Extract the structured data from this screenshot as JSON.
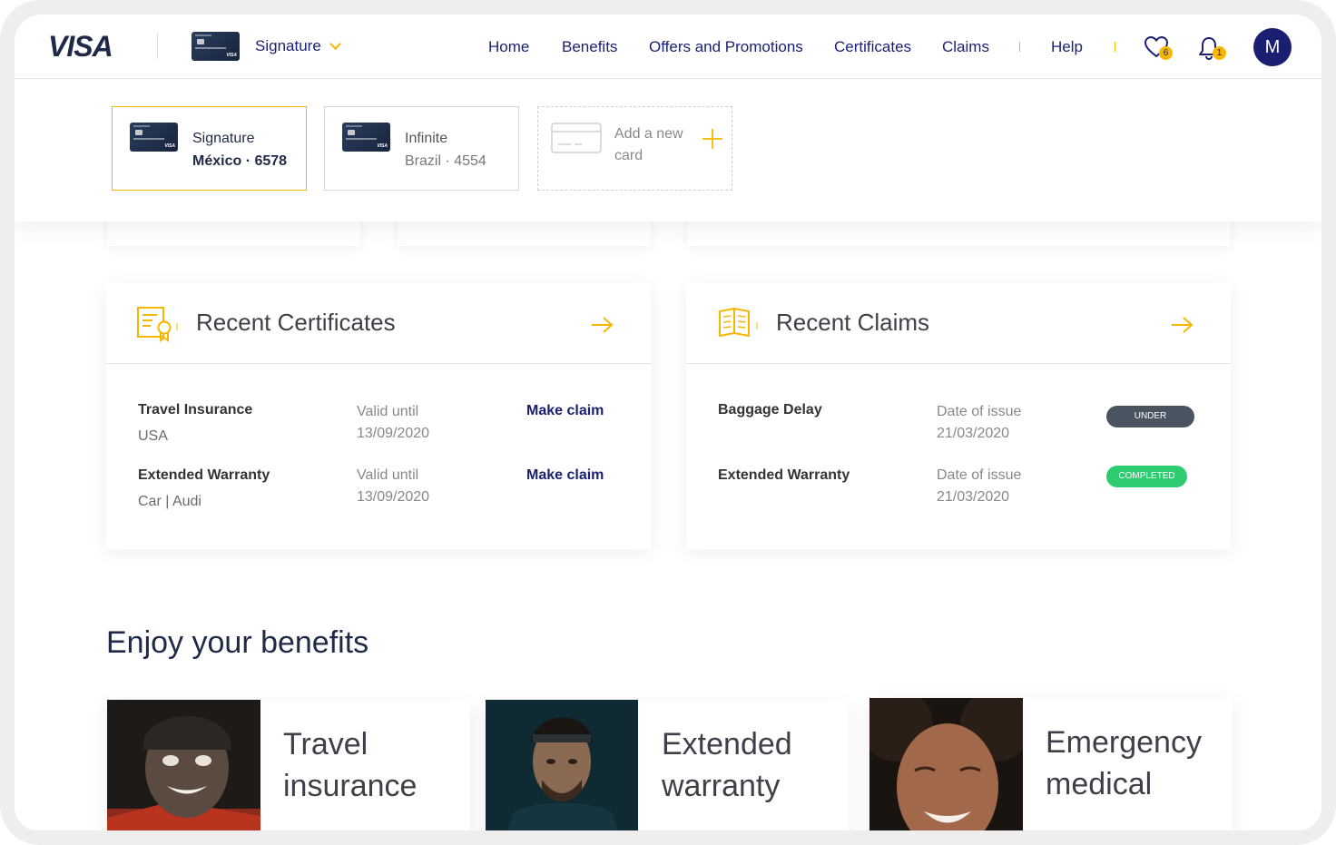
{
  "header": {
    "logo": "VISA",
    "selected_card": "Signature",
    "nav": [
      "Home",
      "Benefits",
      "Offers and Promotions",
      "Certificates",
      "Claims",
      "Help"
    ],
    "favorites_count": "6",
    "notifications_count": "1",
    "avatar_initial": "M"
  },
  "cards": [
    {
      "line1": "Signature",
      "line2": "México · 6578",
      "active": true
    },
    {
      "line1": "Infinite",
      "line2": "Brazil · 4554",
      "active": false
    }
  ],
  "add_card": {
    "line1": "Add a new",
    "line2": "card"
  },
  "certificates": {
    "title": "Recent Certificates",
    "rows": [
      {
        "name": "Travel Insurance",
        "detail": "USA",
        "meta_label": "Valid until",
        "meta_value": "13/09/2020",
        "action": "Make claim"
      },
      {
        "name": "Extended Warranty",
        "detail": "Car | Audi",
        "meta_label": "Valid until",
        "meta_value": "13/09/2020",
        "action": "Make claim"
      }
    ]
  },
  "claims": {
    "title": "Recent Claims",
    "rows": [
      {
        "name": "Baggage Delay",
        "meta_label": "Date of issue",
        "meta_value": "21/03/2020",
        "status": "UNDER REVIEW",
        "status_color": "#4a5360"
      },
      {
        "name": "Extended Warranty",
        "meta_label": "Date of issue",
        "meta_value": "21/03/2020",
        "status": "COMPLETED",
        "status_color": "#2ecc71"
      }
    ]
  },
  "benefits": {
    "title": "Enjoy your benefits",
    "items": [
      {
        "line1": "Travel",
        "line2": "insurance"
      },
      {
        "line1": "Extended",
        "line2": "warranty"
      },
      {
        "line1": "Emergency",
        "line2": "medical"
      }
    ]
  },
  "colors": {
    "accent": "#f7b600",
    "brand": "#1a1f71"
  }
}
